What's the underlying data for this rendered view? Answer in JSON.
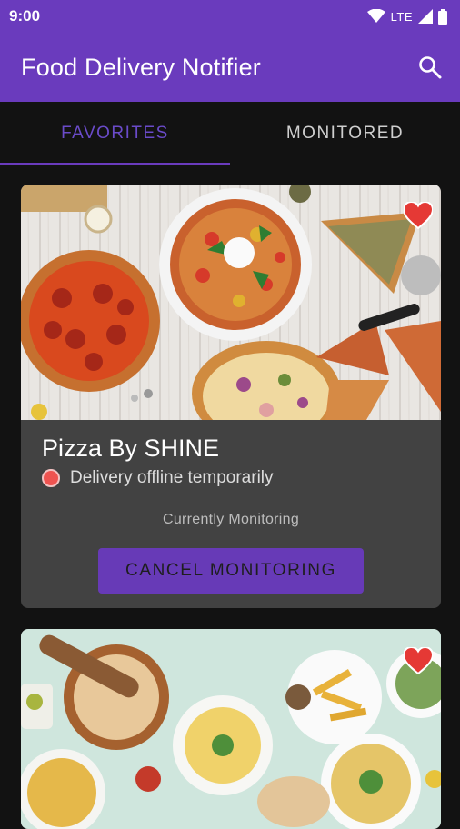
{
  "status_bar": {
    "time": "9:00",
    "network": "LTE"
  },
  "app_bar": {
    "title": "Food Delivery Notifier",
    "search_icon": "search-icon"
  },
  "tabs": [
    {
      "label": "FAVORITES",
      "active": true
    },
    {
      "label": "MONITORED",
      "active": false
    }
  ],
  "cards": [
    {
      "name": "Pizza By SHINE",
      "status": "Delivery offline temporarily",
      "status_color": "#ef5350",
      "monitor_label": "Currently Monitoring",
      "button_label": "CANCEL MONITORING",
      "favorite": true
    },
    {
      "favorite": true
    }
  ],
  "colors": {
    "primary": "#6a3bbd",
    "background": "#121212",
    "card": "#424242",
    "favorite": "#e53935"
  }
}
